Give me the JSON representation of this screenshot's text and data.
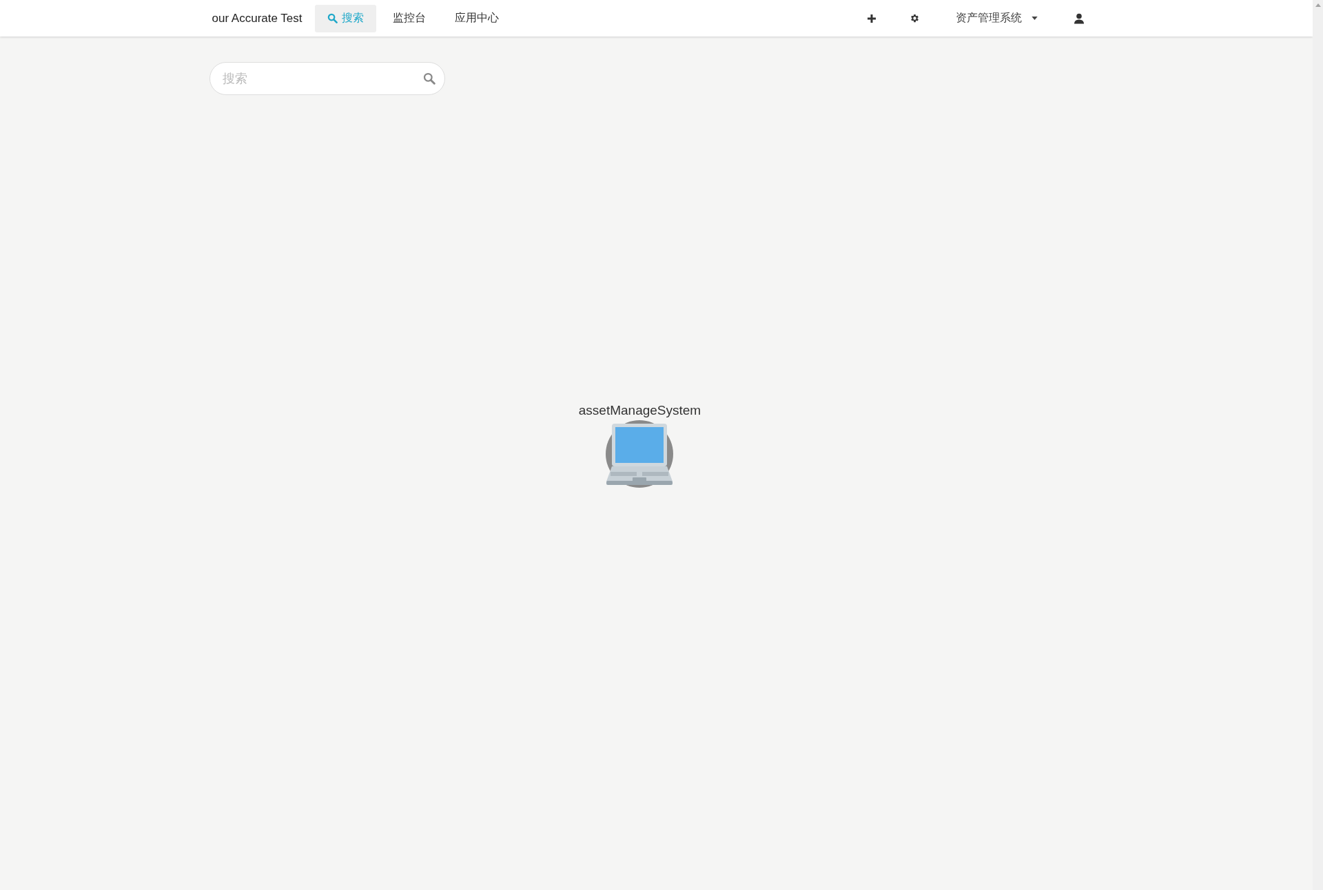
{
  "navbar": {
    "brand": "our Accurate Test",
    "tabs": [
      {
        "label": "搜索",
        "kind": "search",
        "selected": true
      },
      {
        "label": "监控台",
        "kind": "plain",
        "selected": false
      },
      {
        "label": "应用中心",
        "kind": "plain",
        "selected": false
      }
    ],
    "system_menu": {
      "label": "资产管理系统"
    }
  },
  "search": {
    "placeholder": "搜索"
  },
  "topology": {
    "nodes": [
      {
        "label": "assetManageSystem",
        "kind": "laptop"
      }
    ]
  }
}
